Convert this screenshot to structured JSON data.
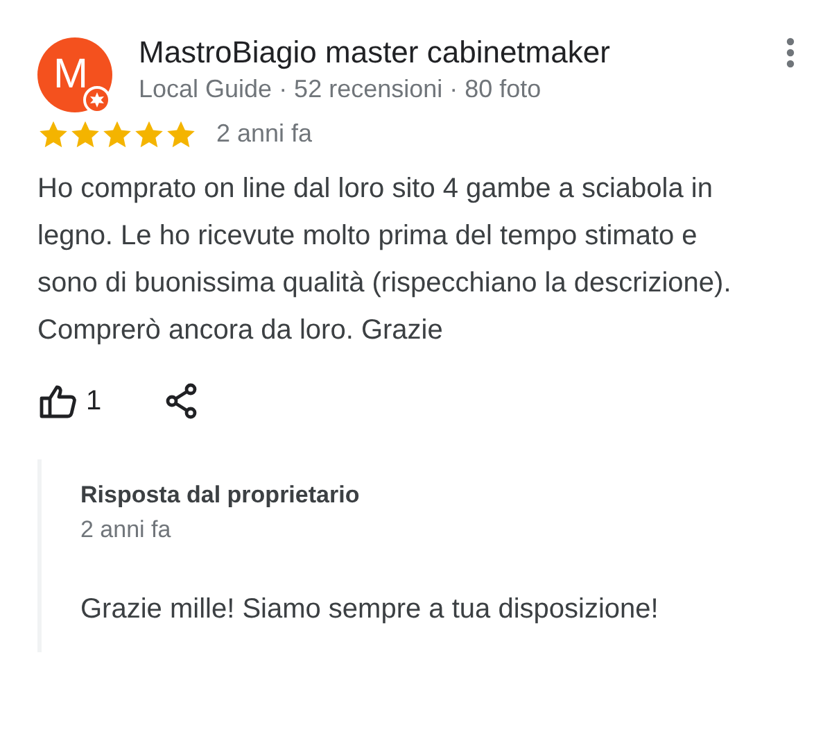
{
  "review": {
    "avatar_letter": "M",
    "author": "MastroBiagio master cabinetmaker",
    "meta": "Local Guide · 52 recensioni · 80 foto",
    "stars": 5,
    "time": "2 anni fa",
    "text": "Ho comprato on line dal loro sito 4 gambe a sciabola in legno. Le ho ricevute molto prima del tempo stimato e sono di buonissima qualità (rispecchiano la descrizione). Comprerò ancora da loro. Grazie",
    "likes": "1"
  },
  "owner_reply": {
    "title": "Risposta dal proprietario",
    "time": "2 anni fa",
    "text": "Grazie mille! Siamo sempre a tua disposizione!"
  }
}
